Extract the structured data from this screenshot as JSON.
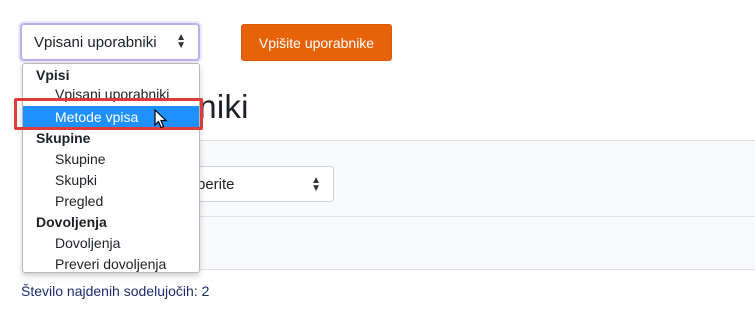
{
  "top_select": {
    "value": "Vpisani uporabniki"
  },
  "enrol_button": {
    "label": "Vpišite uporabnike"
  },
  "heading": {
    "visible_text": "rabniki"
  },
  "filter_select": {
    "visible_text": "berite"
  },
  "participants": {
    "text": "Število najdenih sodelujočih: 2"
  },
  "dropdown": {
    "groups": [
      {
        "label": "Vpisi",
        "options": [
          "Vpisani uporabniki",
          "Metode vpisa"
        ]
      },
      {
        "label": "Skupine",
        "options": [
          "Skupine",
          "Skupki",
          "Pregled"
        ]
      },
      {
        "label": "Dovoljenja",
        "options": [
          "Dovoljenja",
          "Preveri dovoljenja"
        ]
      }
    ],
    "highlighted": "Metode vpisa"
  },
  "colors": {
    "accent": "#e8620a",
    "highlight": "#1e90ff",
    "annotation": "#e03b3b"
  }
}
